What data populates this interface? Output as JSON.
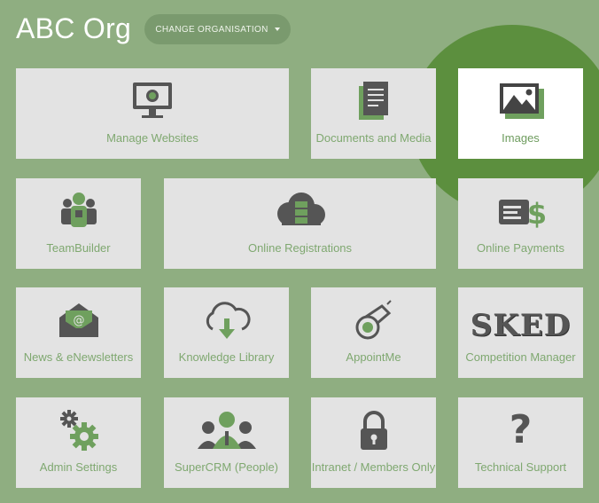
{
  "header": {
    "org_name": "ABC Org",
    "change_button_label": "CHANGE ORGANISATION"
  },
  "tiles": [
    {
      "label": "Manage Websites",
      "icon": "monitor-icon"
    },
    {
      "label": "Documents and Media",
      "icon": "document-icon"
    },
    {
      "label": "Images",
      "icon": "image-icon",
      "highlighted": true
    },
    {
      "label": "TeamBuilder",
      "icon": "team-icon"
    },
    {
      "label": "Online Registrations",
      "icon": "cloud-server-icon"
    },
    {
      "label": "Online Payments",
      "icon": "payments-icon"
    },
    {
      "label": "News & eNewsletters",
      "icon": "envelope-icon"
    },
    {
      "label": "Knowledge Library",
      "icon": "cloud-download-icon"
    },
    {
      "label": "AppointMe",
      "icon": "whistle-icon"
    },
    {
      "label": "Competition Manager",
      "icon": "sked-logo",
      "logo_text": "SKED"
    },
    {
      "label": "Admin Settings",
      "icon": "gears-icon"
    },
    {
      "label": "SuperCRM (People)",
      "icon": "people-icon"
    },
    {
      "label": "Intranet / Members Only",
      "icon": "lock-icon"
    },
    {
      "label": "Technical Support",
      "icon": "question-icon",
      "glyph": "?"
    }
  ],
  "colors": {
    "background": "#8fae81",
    "tile": "#e3e3e3",
    "accent_green": "#6fa05e",
    "spotlight": "#5c8f3e",
    "icon_gray": "#555555"
  }
}
